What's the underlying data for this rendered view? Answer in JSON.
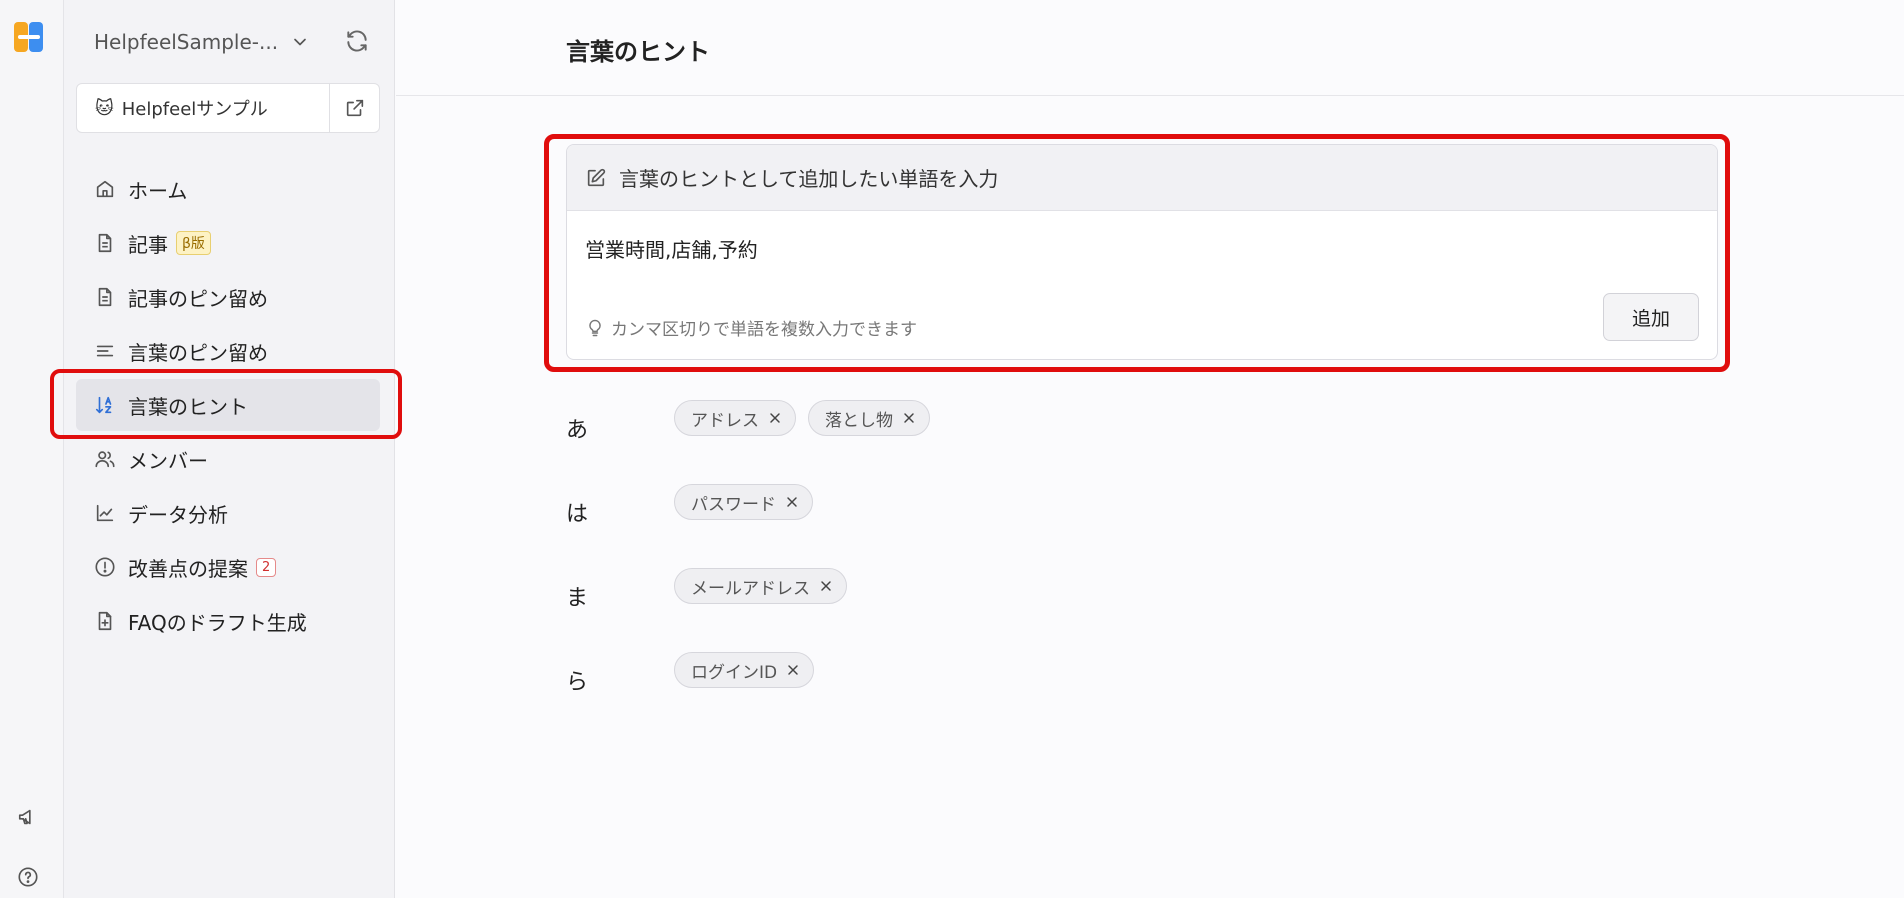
{
  "sidebar": {
    "workspace": "HelpfeelSample-...",
    "project": "Helpfeelサンプル",
    "project_emoji": "🐱",
    "items": [
      {
        "label": "ホーム",
        "icon": "home-icon"
      },
      {
        "label": "記事",
        "icon": "document-icon",
        "badge": "β版"
      },
      {
        "label": "記事のピン留め",
        "icon": "document-icon"
      },
      {
        "label": "言葉のピン留め",
        "icon": "lines-icon"
      },
      {
        "label": "言葉のヒント",
        "icon": "sort-az-icon",
        "active": true
      },
      {
        "label": "メンバー",
        "icon": "members-icon"
      },
      {
        "label": "データ分析",
        "icon": "chart-icon"
      },
      {
        "label": "改善点の提案",
        "icon": "alert-circle-icon",
        "count": "2"
      },
      {
        "label": "FAQのドラフト生成",
        "icon": "file-plus-icon"
      }
    ]
  },
  "page": {
    "title": "言葉のヒント"
  },
  "input_card": {
    "heading": "言葉のヒントとして追加したい単語を入力",
    "value": "営業時間,店舗,予約",
    "hint": "カンマ区切りで単語を複数入力できます",
    "add_label": "追加"
  },
  "groups": [
    {
      "letter": "あ",
      "tags": [
        "アドレス",
        "落とし物"
      ]
    },
    {
      "letter": "は",
      "tags": [
        "パスワード"
      ]
    },
    {
      "letter": "ま",
      "tags": [
        "メールアドレス"
      ]
    },
    {
      "letter": "ら",
      "tags": [
        "ログインID"
      ]
    }
  ],
  "colors": {
    "highlight": "#e00d0d",
    "accent": "#2f6fd6",
    "logo_left": "#f6a722",
    "logo_right": "#3d8ef0"
  }
}
